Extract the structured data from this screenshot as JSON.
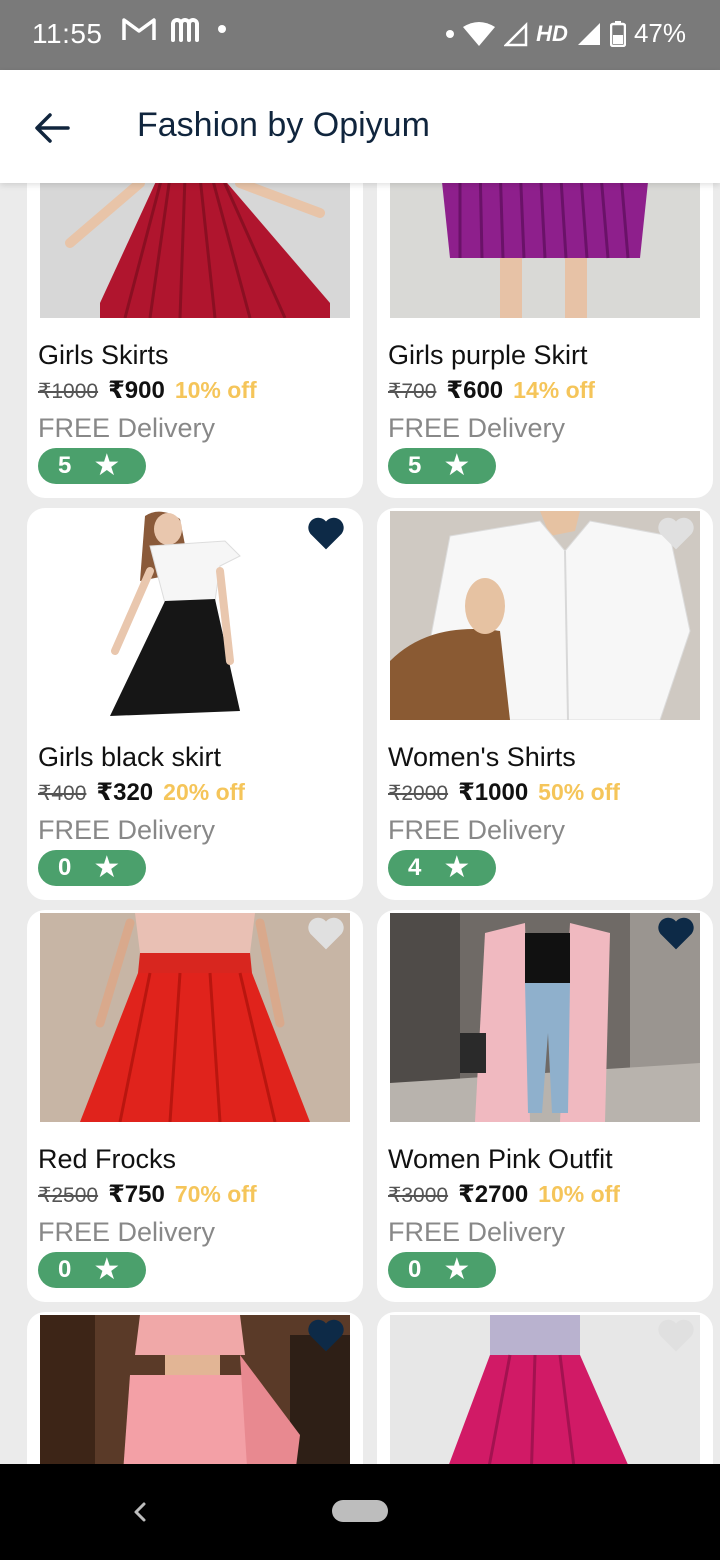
{
  "status_bar": {
    "time": "11:55",
    "left_icons": [
      "gmail-icon",
      "m-app-icon"
    ],
    "battery": "47%",
    "network": "HD"
  },
  "app_bar": {
    "title": "Fashion by Opiyum"
  },
  "colors": {
    "accent_green": "#4ba06c",
    "discount_yellow": "#f5c55a",
    "heart_filled": "#0d2a47",
    "heart_empty": "#e0e0e0"
  },
  "products": [
    {
      "name": "Girls Skirts",
      "old_price": "₹1000",
      "price": "₹900",
      "discount": "10% off",
      "delivery": "FREE Delivery",
      "rating": "5",
      "favorite": false,
      "image": "red-pleated-skirt"
    },
    {
      "name": "Girls purple Skirt",
      "old_price": "₹700",
      "price": "₹600",
      "discount": "14% off",
      "delivery": "FREE Delivery",
      "rating": "5",
      "favorite": false,
      "image": "purple-pleated-skirt"
    },
    {
      "name": "Girls black skirt",
      "old_price": "₹400",
      "price": "₹320",
      "discount": "20% off",
      "delivery": "FREE Delivery",
      "rating": "0",
      "favorite": true,
      "image": "black-skirt-white-top"
    },
    {
      "name": "Women's Shirts",
      "old_price": "₹2000",
      "price": "₹1000",
      "discount": "50% off",
      "delivery": "FREE Delivery",
      "rating": "4",
      "favorite": false,
      "image": "white-shirt"
    },
    {
      "name": "Red Frocks",
      "old_price": "₹2500",
      "price": "₹750",
      "discount": "70% off",
      "delivery": "FREE Delivery",
      "rating": "0",
      "favorite": false,
      "image": "red-frock"
    },
    {
      "name": "Women Pink Outfit",
      "old_price": "₹3000",
      "price": "₹2700",
      "discount": "10% off",
      "delivery": "FREE Delivery",
      "rating": "0",
      "favorite": true,
      "image": "pink-coat-outfit"
    },
    {
      "name": "",
      "old_price": "",
      "price": "",
      "discount": "",
      "delivery": "",
      "rating": "",
      "favorite": true,
      "image": "pink-saree"
    },
    {
      "name": "",
      "old_price": "",
      "price": "",
      "discount": "",
      "delivery": "",
      "rating": "",
      "favorite": false,
      "image": "magenta-skirt"
    }
  ]
}
